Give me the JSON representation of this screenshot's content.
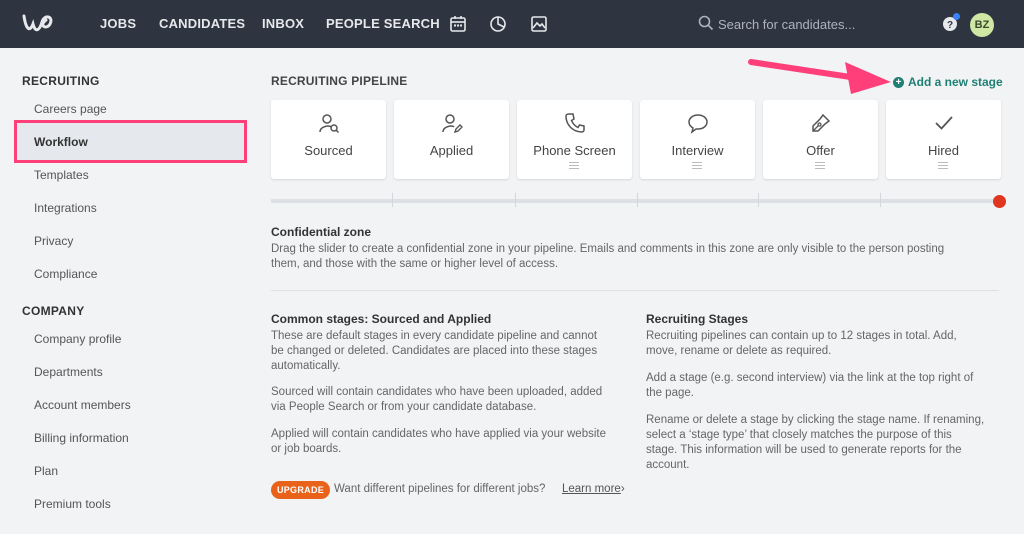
{
  "nav": {
    "items": [
      "JOBS",
      "CANDIDATES",
      "INBOX",
      "PEOPLE SEARCH"
    ],
    "icons": [
      "calendar-icon",
      "pie-chart-icon",
      "image-icon"
    ],
    "search_placeholder": "Search for candidates...",
    "avatar": "BZ",
    "notification_color": "#3a82f7"
  },
  "sidebar": {
    "recruiting_heading": "RECRUITING",
    "recruiting_items": [
      "Careers page",
      "Workflow",
      "Templates",
      "Integrations",
      "Privacy",
      "Compliance"
    ],
    "active_item": "Workflow",
    "company_heading": "COMPANY",
    "company_items": [
      "Company profile",
      "Departments",
      "Account members",
      "Billing information",
      "Plan",
      "Premium tools"
    ],
    "highlight_color": "#ff3f7a"
  },
  "main": {
    "title": "RECRUITING PIPELINE",
    "add_stage": "Add a new stage",
    "stages": [
      {
        "label": "Sourced",
        "icon": "user-search-icon"
      },
      {
        "label": "Applied",
        "icon": "user-edit-icon"
      },
      {
        "label": "Phone Screen",
        "icon": "phone-icon"
      },
      {
        "label": "Interview",
        "icon": "chat-bubble-icon"
      },
      {
        "label": "Offer",
        "icon": "pen-nib-icon"
      },
      {
        "label": "Hired",
        "icon": "checkmark-icon"
      }
    ],
    "confidential": {
      "title": "Confidential zone",
      "line1": "Drag the slider to create a confidential zone in your pipeline. Emails and comments in this zone are only visible to the person posting",
      "line2": "them, and those with the same or higher level of access."
    },
    "common": {
      "title": "Common stages: Sourced and Applied",
      "p1": [
        "These are default stages in every candidate pipeline and cannot",
        "be changed or deleted. Candidates are placed into these stages",
        "automatically."
      ],
      "p2": [
        "Sourced will contain candidates who have been uploaded, added",
        "via People Search or from your candidate database."
      ],
      "p3": [
        "Applied will contain candidates who have applied via your website",
        "or job boards."
      ]
    },
    "recruiting_stages": {
      "title": "Recruiting Stages",
      "p1": [
        "Recruiting pipelines can contain up to 12 stages in total. Add,",
        "move, rename or delete as required."
      ],
      "p2": [
        "Add a stage (e.g. second interview) via the link at the top right of",
        "the page."
      ],
      "p3": [
        "Rename or delete a stage by clicking the stage name. If renaming,",
        "select a ‘stage type’ that closely matches the purpose of this",
        "stage. This information will be used to generate reports for the",
        "account."
      ]
    },
    "upgrade": {
      "badge": "UPGRADE",
      "text": "Want different pipelines for different jobs?",
      "link": "Learn more",
      "chevron": "›"
    }
  }
}
